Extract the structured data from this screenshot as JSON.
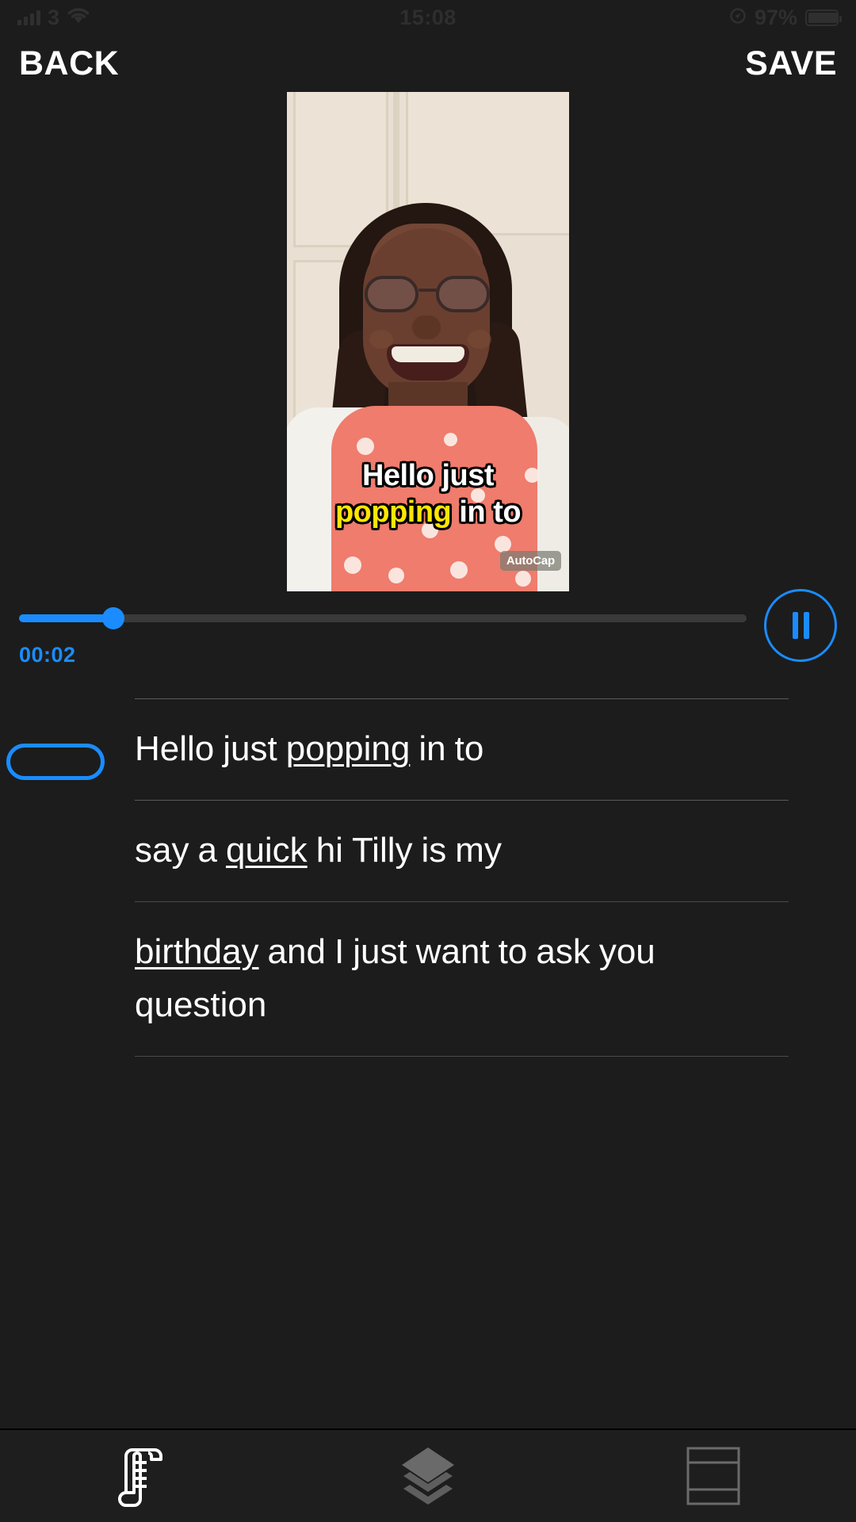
{
  "statusbar": {
    "carrier_label": "3",
    "time": "15:08",
    "battery_percent": "97%",
    "signal_icon": "signal-bars-icon",
    "wifi_icon": "wifi-icon",
    "location_icon": "location-arrow-icon",
    "battery_icon": "battery-icon"
  },
  "navbar": {
    "back_label": "BACK",
    "save_label": "SAVE"
  },
  "preview": {
    "watermark": "AutoCap",
    "caption_lines": [
      {
        "words": [
          {
            "text": "Hello",
            "highlight": false
          },
          {
            "text": "just",
            "highlight": false
          }
        ]
      },
      {
        "words": [
          {
            "text": "popping",
            "highlight": true
          },
          {
            "text": "in",
            "highlight": false
          },
          {
            "text": "to",
            "highlight": false
          }
        ]
      }
    ],
    "highlight_color": "#ffe600",
    "caption_color": "#ffffff"
  },
  "player": {
    "current_time": "00:02",
    "progress_percent": 13,
    "state_icon": "pause-icon",
    "accent_color": "#1a8cff"
  },
  "transcript": {
    "segments": [
      {
        "selected": true,
        "words": [
          {
            "text": "Hello",
            "underline": false
          },
          {
            "text": "just",
            "underline": false
          },
          {
            "text": "popping",
            "underline": true
          },
          {
            "text": "in",
            "underline": false
          },
          {
            "text": "to",
            "underline": false
          }
        ]
      },
      {
        "selected": false,
        "words": [
          {
            "text": "say",
            "underline": false
          },
          {
            "text": "a",
            "underline": false
          },
          {
            "text": "quick",
            "underline": true
          },
          {
            "text": "hi",
            "underline": false
          },
          {
            "text": "Tilly",
            "underline": false
          },
          {
            "text": "is",
            "underline": false
          },
          {
            "text": "my",
            "underline": false
          }
        ]
      },
      {
        "selected": false,
        "words": [
          {
            "text": "birthday",
            "underline": true
          },
          {
            "text": "and",
            "underline": false
          },
          {
            "text": "I",
            "underline": false
          },
          {
            "text": "just",
            "underline": false
          },
          {
            "text": "want",
            "underline": false
          },
          {
            "text": "to",
            "underline": false
          },
          {
            "text": "ask",
            "underline": false
          },
          {
            "text": "you",
            "underline": false
          },
          {
            "text": "question",
            "underline": false
          }
        ]
      }
    ]
  },
  "tabbar": {
    "tabs": [
      {
        "name": "script-tab",
        "icon": "scroll-icon",
        "active": true
      },
      {
        "name": "layers-tab",
        "icon": "layers-icon",
        "active": false
      },
      {
        "name": "template-tab",
        "icon": "frame-icon",
        "active": false
      }
    ]
  }
}
